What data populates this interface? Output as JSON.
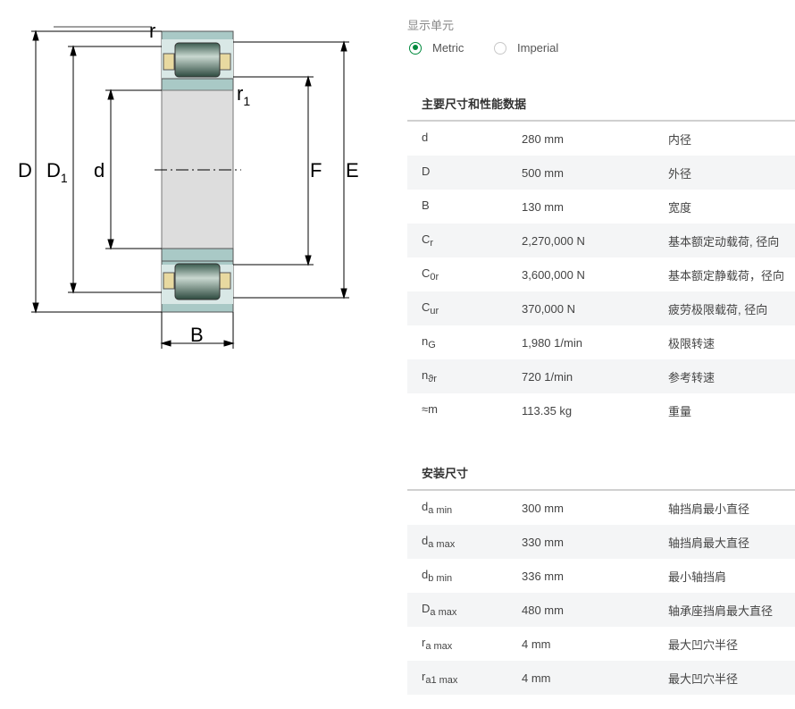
{
  "diagram": {
    "labels": {
      "r": "r",
      "r1_main": "r",
      "r1_sub": "1",
      "D": "D",
      "D1_main": "D",
      "D1_sub": "1",
      "d": "d",
      "F": "F",
      "E": "E",
      "B": "B"
    }
  },
  "units": {
    "label": "显示单元",
    "options": [
      {
        "label": "Metric",
        "checked": true
      },
      {
        "label": "Imperial",
        "checked": false
      }
    ]
  },
  "main_dims": {
    "title": "主要尺寸和性能数据",
    "rows": [
      {
        "sym": "d",
        "sub": "",
        "value": "280 mm",
        "desc": "内径"
      },
      {
        "sym": "D",
        "sub": "",
        "value": "500 mm",
        "desc": "外径"
      },
      {
        "sym": "B",
        "sub": "",
        "value": "130 mm",
        "desc": "宽度"
      },
      {
        "sym": "C",
        "sub": "r",
        "value": "2,270,000 N",
        "desc": "基本额定动载荷, 径向"
      },
      {
        "sym": "C",
        "sub": "0r",
        "value": "3,600,000 N",
        "desc": "基本额定静载荷，径向"
      },
      {
        "sym": "C",
        "sub": "ur",
        "value": "370,000 N",
        "desc": "疲劳极限载荷, 径向"
      },
      {
        "sym": "n",
        "sub": "G",
        "value": "1,980 1/min",
        "desc": "极限转速"
      },
      {
        "sym": "n",
        "sub": "ϑr",
        "value": "720 1/min",
        "desc": "参考转速"
      },
      {
        "sym": "≈m",
        "sub": "",
        "value": "113.35 kg",
        "desc": "重量"
      }
    ]
  },
  "mounting_dims": {
    "title": "安装尺寸",
    "rows": [
      {
        "sym": "d",
        "sub": "a min",
        "value": "300 mm",
        "desc": "轴挡肩最小直径"
      },
      {
        "sym": "d",
        "sub": "a max",
        "value": "330 mm",
        "desc": "轴挡肩最大直径"
      },
      {
        "sym": "d",
        "sub": "b min",
        "value": "336 mm",
        "desc": "最小轴挡肩"
      },
      {
        "sym": "D",
        "sub": "a max",
        "value": "480 mm",
        "desc": "轴承座挡肩最大直径"
      },
      {
        "sym": "r",
        "sub": "a max",
        "value": "4 mm",
        "desc": "最大凹穴半径"
      },
      {
        "sym": "r",
        "sub": "a1 max",
        "value": "4 mm",
        "desc": "最大凹穴半径"
      }
    ]
  }
}
